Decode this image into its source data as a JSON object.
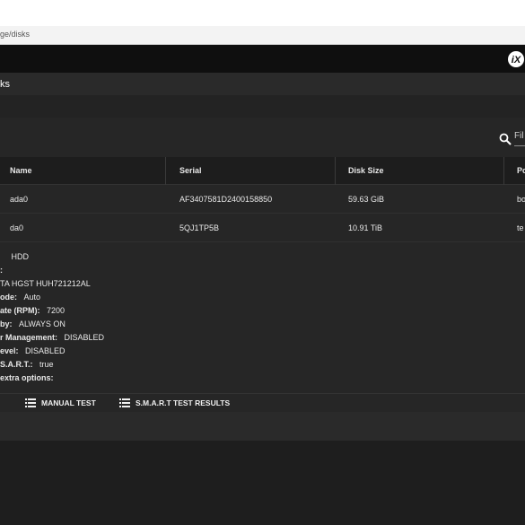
{
  "browser": {
    "url_fragment": "ge/disks"
  },
  "breadcrumb": "ks",
  "search": {
    "placeholder": "Fil"
  },
  "table": {
    "columns": [
      "Name",
      "Serial",
      "Disk Size",
      "Po"
    ],
    "rows": [
      {
        "name": "ada0",
        "serial": "AF3407581D2400158850",
        "size": "59.63 GiB",
        "pool": "bo"
      },
      {
        "name": "da0",
        "serial": "5QJ1TP5B",
        "size": "10.91 TiB",
        "pool": "te"
      }
    ]
  },
  "details": [
    {
      "key": "",
      "value": "HDD"
    },
    {
      "key": ":",
      "value": ""
    },
    {
      "key": "",
      "value": "TA HGST HUH721212AL"
    },
    {
      "key": "ode:",
      "value": "Auto"
    },
    {
      "key": "ate (RPM):",
      "value": "7200"
    },
    {
      "key": "by:",
      "value": "ALWAYS ON"
    },
    {
      "key": "r Management:",
      "value": "DISABLED"
    },
    {
      "key": "evel:",
      "value": "DISABLED"
    },
    {
      "key": "S.A.R.T.:",
      "value": "true"
    },
    {
      "key": "extra options:",
      "value": ""
    }
  ],
  "actions": {
    "manual_test": "MANUAL TEST",
    "smart_results": "S.M.A.R.T TEST RESULTS"
  }
}
